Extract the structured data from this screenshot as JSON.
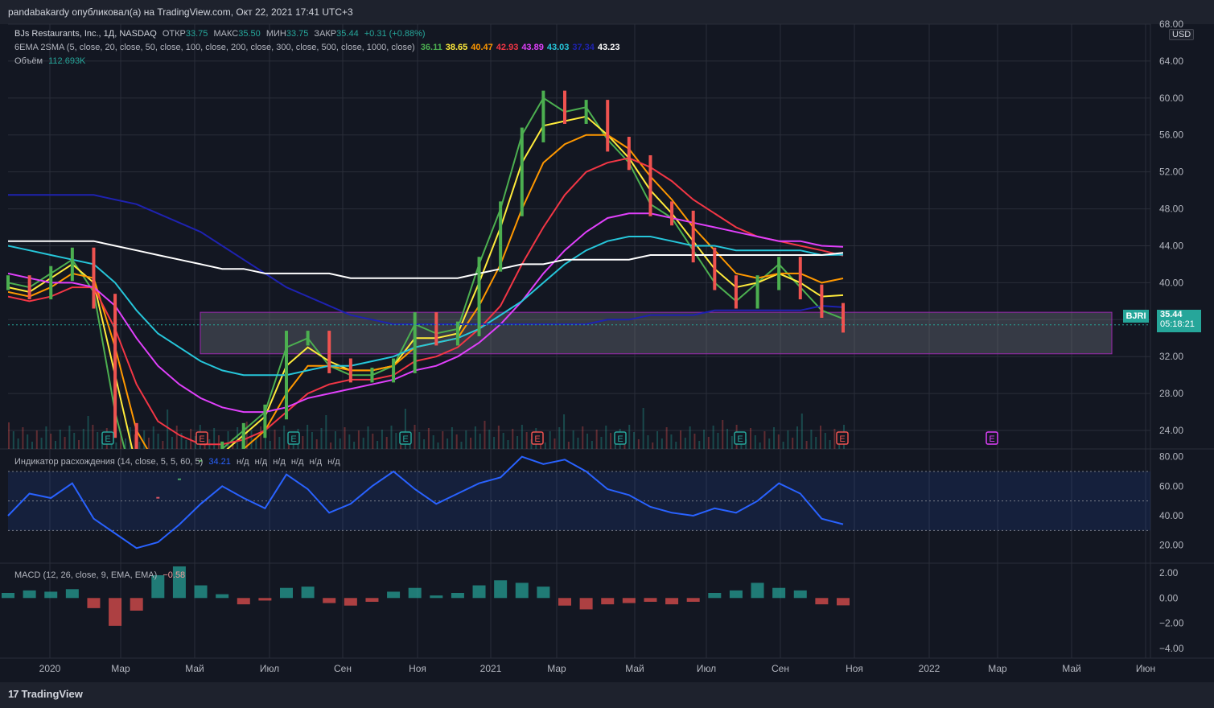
{
  "header": {
    "published": "pandabakardy опубликовал(а) на TradingView.com, Окт 22, 2021 17:41 UTC+3"
  },
  "legend": {
    "symbol_title": "BJs Restaurants, Inc., 1Д, NASDAQ",
    "open_label": "ОТКР",
    "open": "33.75",
    "high_label": "МАКС",
    "high": "35.50",
    "low_label": "МИН",
    "low": "33.75",
    "close_label": "ЗАКР",
    "close": "35.44",
    "change": "+0.31 (+0.88%)",
    "ma_title": "6EMA 2SMA (5, close, 20, close, 50, close, 100, close, 200, close, 300, close, 500, close, 1000, close)",
    "ma_values": [
      {
        "value": "36.11",
        "color": "#4caf50"
      },
      {
        "value": "38.65",
        "color": "#ffeb3b"
      },
      {
        "value": "40.47",
        "color": "#ff9800"
      },
      {
        "value": "42.93",
        "color": "#f23645"
      },
      {
        "value": "43.89",
        "color": "#e040fb"
      },
      {
        "value": "43.03",
        "color": "#26c6da"
      },
      {
        "value": "37.34",
        "color": "#1e22b0"
      },
      {
        "value": "43.23",
        "color": "#ffffff"
      }
    ],
    "volume_label": "Объём",
    "volume": "112.693K"
  },
  "price_axis": {
    "currency": "USD",
    "ticks": [
      "68.00",
      "64.00",
      "60.00",
      "56.00",
      "52.00",
      "48.00",
      "44.00",
      "40.00",
      "36.00",
      "32.00",
      "28.00",
      "24.00"
    ],
    "symbol_badge": "BJRI",
    "last_price": "35.44",
    "countdown": "05:18:21"
  },
  "time_axis": {
    "labels": [
      "2020",
      "Мар",
      "Май",
      "Июл",
      "Сен",
      "Ноя",
      "2021",
      "Мар",
      "Май",
      "Июл",
      "Сен",
      "Ноя",
      "2022",
      "Мар",
      "Май",
      "Июн"
    ]
  },
  "earnings_marker": "E",
  "divergence": {
    "title": "Индикатор расхождения (14, close, 5, 5, 60, 5)",
    "value": "34.21",
    "na_values": [
      "н/д",
      "н/д",
      "н/д",
      "н/д",
      "н/д",
      "н/д"
    ],
    "ticks": [
      "80.00",
      "60.00",
      "40.00",
      "20.00"
    ]
  },
  "macd": {
    "title": "MACD (12, 26, close, 9, EMA, EMA)",
    "value": "−0.58",
    "ticks": [
      "2.00",
      "0.00",
      "−2.00",
      "−4.00"
    ]
  },
  "footer": {
    "brand": "TradingView"
  },
  "colors": {
    "background": "#131722",
    "grid": "#2a2e39",
    "up": "#26a69a",
    "down": "#ef5350",
    "candle_up": "#4caf50",
    "rsi": "#2962ff",
    "zone": "#787b86",
    "zone_border": "#9c27b0"
  },
  "chart_data": {
    "type": "line",
    "title": "BJs Restaurants, Inc., 1Д, NASDAQ",
    "x_labels": [
      "2020",
      "Мар",
      "Май",
      "Июл",
      "Сен",
      "Ноя",
      "2021",
      "Мар",
      "Май",
      "Июл",
      "Сен",
      "Ноя",
      "2022",
      "Мар",
      "Май",
      "Июн"
    ],
    "price_range": [
      22,
      68
    ],
    "price": [
      40,
      39,
      41,
      43,
      38,
      24,
      16,
      14,
      18,
      20,
      22,
      24,
      26,
      34,
      34,
      31,
      30,
      30,
      31,
      36,
      34,
      35,
      42,
      48,
      56,
      60,
      58,
      59,
      55,
      53,
      48,
      47,
      43,
      40,
      38,
      40,
      42,
      39,
      37,
      35.4
    ],
    "series": [
      {
        "name": "EMA 5",
        "color": "#4caf50",
        "values": [
          40,
          39.5,
          41,
          42.5,
          39,
          26,
          17,
          15,
          18,
          20,
          22,
          24,
          26,
          33,
          34,
          31,
          30,
          30,
          31,
          35.5,
          34.5,
          35,
          42,
          48,
          56,
          60,
          58.5,
          59,
          55.5,
          53,
          48.5,
          47,
          43.5,
          40,
          38,
          40,
          42,
          39.5,
          37,
          36.1
        ]
      },
      {
        "name": "EMA 20",
        "color": "#ffeb3b",
        "values": [
          39.5,
          39,
          40.5,
          42,
          40,
          30,
          20,
          17,
          18,
          19.5,
          21.5,
          23.5,
          25.5,
          31,
          33,
          31.5,
          30.5,
          30.5,
          31,
          34,
          34,
          34.5,
          40,
          46,
          53,
          57,
          57.5,
          58,
          56,
          53.5,
          50,
          47.5,
          44.5,
          41.5,
          39.5,
          40,
          41,
          40,
          38.5,
          38.65
        ]
      },
      {
        "name": "EMA 50",
        "color": "#ff9800",
        "values": [
          39,
          38.5,
          39.5,
          41,
          40.5,
          33,
          24,
          20,
          19.5,
          19.5,
          20.5,
          22,
          24,
          28,
          31,
          31,
          30.5,
          30.5,
          31,
          33,
          33.5,
          34,
          37.5,
          42,
          48,
          53,
          55,
          56,
          56,
          54.5,
          51.5,
          49,
          46,
          43.5,
          41,
          40.5,
          41,
          41,
          40,
          40.47
        ]
      },
      {
        "name": "EMA 100",
        "color": "#f23645",
        "values": [
          38.5,
          38,
          38.5,
          39.5,
          39.5,
          35,
          29,
          25,
          23.5,
          22.5,
          22.5,
          23,
          24,
          26,
          28,
          29,
          29.5,
          29.5,
          30,
          31.5,
          32,
          33,
          35,
          37.5,
          42,
          46,
          49.5,
          52,
          53,
          53.5,
          52.5,
          51,
          49,
          47.5,
          46,
          45,
          44.5,
          44,
          43.5,
          42.93
        ]
      },
      {
        "name": "EMA 200",
        "color": "#e040fb",
        "values": [
          41,
          40.5,
          40,
          40,
          39.5,
          37.5,
          34,
          31,
          29,
          27.5,
          26.5,
          26,
          26,
          26.5,
          27.5,
          28,
          28.5,
          29,
          29.5,
          30.5,
          31,
          32,
          33.5,
          35.5,
          38,
          41,
          43.5,
          45.5,
          47,
          47.5,
          47.5,
          47,
          46.5,
          46,
          45.5,
          45,
          44.5,
          44.5,
          44,
          43.89
        ]
      },
      {
        "name": "EMA 300",
        "color": "#26c6da",
        "values": [
          44,
          43.5,
          43,
          42.5,
          42,
          40,
          37,
          34.5,
          33,
          31.5,
          30.5,
          30,
          30,
          30,
          30.5,
          31,
          31,
          31.5,
          32,
          33,
          33.5,
          34,
          35,
          36.5,
          38,
          40,
          42,
          43.5,
          44.5,
          45,
          45,
          44.5,
          44,
          44,
          43.5,
          43.5,
          43.5,
          43.5,
          43,
          43.03
        ]
      },
      {
        "name": "SMA 500",
        "color": "#1e22b0",
        "values": [
          49.5,
          49.5,
          49.5,
          49.5,
          49.5,
          49,
          48.5,
          47.5,
          46.5,
          45.5,
          44,
          42.5,
          41,
          39.5,
          38.5,
          37.5,
          36.5,
          36,
          35.5,
          35.5,
          35.5,
          35.5,
          35.5,
          35.5,
          35.5,
          35.5,
          35.5,
          35.5,
          36,
          36,
          36.5,
          36.5,
          36.5,
          37,
          37,
          37,
          37,
          37,
          37.5,
          37.34
        ]
      },
      {
        "name": "SMA 1000",
        "color": "#ffffff",
        "values": [
          44.5,
          44.5,
          44.5,
          44.5,
          44.5,
          44,
          43.5,
          43,
          42.5,
          42,
          41.5,
          41.5,
          41,
          41,
          41,
          41,
          40.5,
          40.5,
          40.5,
          40.5,
          40.5,
          40.5,
          41,
          41.5,
          42,
          42,
          42.5,
          42.5,
          42.5,
          42.5,
          43,
          43,
          43,
          43,
          43,
          43,
          43,
          43,
          43,
          43.23
        ]
      }
    ],
    "zone": {
      "from_index": 10,
      "to_index": 56,
      "low": 32.3,
      "high": 36.8
    },
    "divergence_values": [
      40,
      55,
      52,
      62,
      38,
      28,
      18,
      22,
      34,
      48,
      60,
      52,
      45,
      68,
      58,
      42,
      48,
      60,
      70,
      58,
      48,
      55,
      62,
      66,
      80,
      75,
      78,
      70,
      58,
      54,
      46,
      42,
      40,
      45,
      42,
      50,
      62,
      55,
      38,
      34.21
    ],
    "divergence_range": [
      10,
      82
    ],
    "macd_hist": [
      0.4,
      0.6,
      0.5,
      0.7,
      -0.8,
      -2.2,
      -1,
      1.8,
      2.5,
      1,
      0.3,
      -0.5,
      -0.2,
      0.8,
      0.9,
      -0.4,
      -0.6,
      -0.3,
      0.5,
      0.8,
      0.2,
      0.4,
      1.0,
      1.4,
      1.2,
      0.9,
      -0.6,
      -0.9,
      -0.5,
      -0.4,
      -0.3,
      -0.5,
      -0.3,
      0.4,
      0.6,
      1.2,
      0.8,
      0.6,
      -0.5,
      -0.58
    ],
    "macd_range": [
      -4.5,
      2.5
    ]
  }
}
